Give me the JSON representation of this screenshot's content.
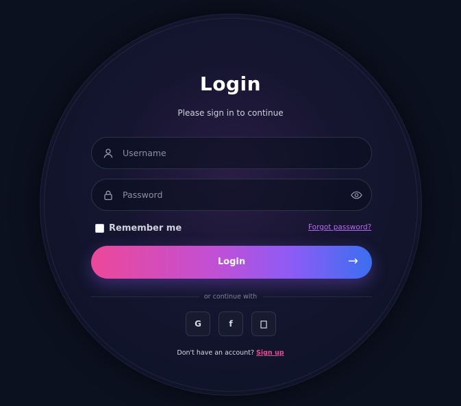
{
  "login": {
    "title": "Login",
    "subtitle": "Please sign in to continue"
  },
  "fields": {
    "username": {
      "placeholder": "Username",
      "value": ""
    },
    "password": {
      "placeholder": "Password",
      "value": ""
    }
  },
  "options": {
    "remember_label": "Remember me",
    "remember_checked": false,
    "forgot_label": "Forgot password?"
  },
  "actions": {
    "login_label": "Login",
    "login_arrow": "→"
  },
  "social": {
    "divider_text": "or continue with",
    "buttons": [
      {
        "label": "G",
        "icon": "google-icon"
      },
      {
        "label": "f",
        "icon": "facebook-icon"
      },
      {
        "label": "",
        "icon": "apple-icon"
      }
    ]
  },
  "signup": {
    "prompt": "Don't have an account?",
    "link_label": "Sign up"
  },
  "colors": {
    "background": "#0c1120",
    "accent_pink": "#ec4899",
    "accent_purple": "#8b5cf6",
    "accent_blue": "#3b6ff0",
    "link_purple": "#b56cf0"
  }
}
